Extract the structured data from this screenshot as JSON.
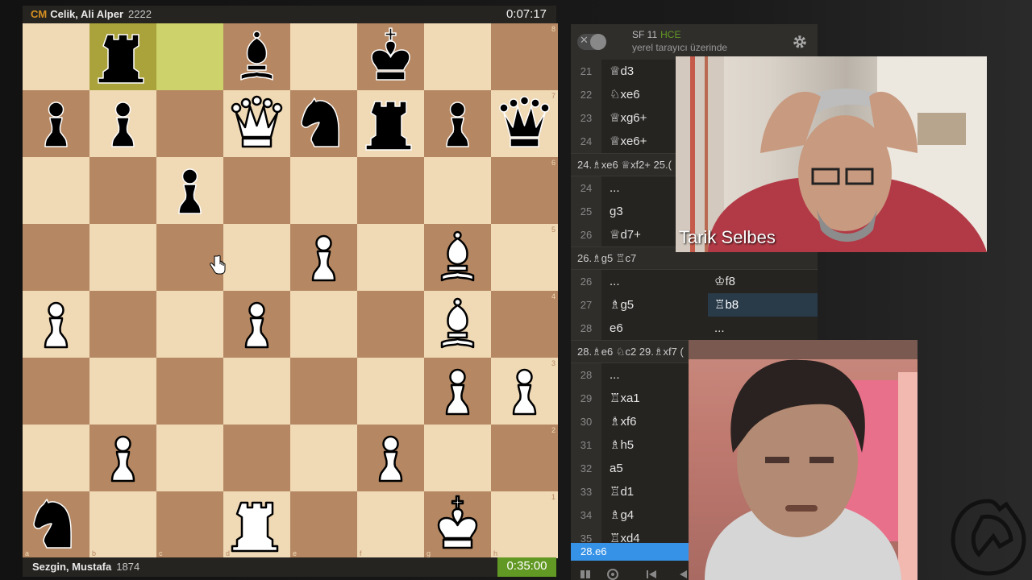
{
  "top_player": {
    "title": "CM",
    "name": "Celik, Ali Alper",
    "rating": "2222",
    "clock": "0:07:17"
  },
  "bottom_player": {
    "name": "Sezgin, Mustafa",
    "rating": "1874",
    "clock": "0:35:00"
  },
  "board": {
    "orientation": "white",
    "highlight_squares": [
      "b8",
      "c8"
    ],
    "pieces": [
      {
        "square": "b8",
        "piece": "rook",
        "color": "black"
      },
      {
        "square": "d8",
        "piece": "bishop",
        "color": "black"
      },
      {
        "square": "f8",
        "piece": "king",
        "color": "black"
      },
      {
        "square": "a7",
        "piece": "pawn",
        "color": "black"
      },
      {
        "square": "b7",
        "piece": "pawn",
        "color": "black"
      },
      {
        "square": "d7",
        "piece": "queen",
        "color": "white"
      },
      {
        "square": "e7",
        "piece": "knight",
        "color": "black"
      },
      {
        "square": "f7",
        "piece": "rook",
        "color": "black"
      },
      {
        "square": "g7",
        "piece": "pawn",
        "color": "black"
      },
      {
        "square": "h7",
        "piece": "queen",
        "color": "black"
      },
      {
        "square": "c6",
        "piece": "pawn",
        "color": "black"
      },
      {
        "square": "e5",
        "piece": "pawn",
        "color": "white"
      },
      {
        "square": "g5",
        "piece": "bishop",
        "color": "white"
      },
      {
        "square": "a4",
        "piece": "pawn",
        "color": "white"
      },
      {
        "square": "d4",
        "piece": "pawn",
        "color": "white"
      },
      {
        "square": "g4",
        "piece": "bishop",
        "color": "white"
      },
      {
        "square": "g3",
        "piece": "pawn",
        "color": "white"
      },
      {
        "square": "h3",
        "piece": "pawn",
        "color": "white"
      },
      {
        "square": "b2",
        "piece": "pawn",
        "color": "white"
      },
      {
        "square": "f2",
        "piece": "pawn",
        "color": "white"
      },
      {
        "square": "a1",
        "piece": "knight",
        "color": "black"
      },
      {
        "square": "d1",
        "piece": "rook",
        "color": "white"
      },
      {
        "square": "g1",
        "piece": "king",
        "color": "white"
      }
    ],
    "rank_labels": [
      "8",
      "7",
      "6",
      "5",
      "4",
      "3",
      "2",
      "1"
    ],
    "file_labels": [
      "a",
      "b",
      "c",
      "d",
      "e",
      "f",
      "g",
      "h"
    ]
  },
  "engine": {
    "name": "SF 11",
    "mode": "HCE",
    "subtitle": "yerel tarayıcı üzerinde"
  },
  "moves": [
    {
      "type": "row",
      "num": "21",
      "white": "♕d3",
      "black": ""
    },
    {
      "type": "row",
      "num": "22",
      "white": "♘xe6",
      "black": ""
    },
    {
      "type": "row",
      "num": "23",
      "white": "♕xg6+",
      "black": ""
    },
    {
      "type": "row",
      "num": "24",
      "white": "♕xe6+",
      "black": ""
    },
    {
      "type": "comment",
      "text": "24.♗xe6 ♕xf2+ 25.("
    },
    {
      "type": "row",
      "num": "24",
      "white": "...",
      "black": ""
    },
    {
      "type": "row",
      "num": "25",
      "white": "g3",
      "black": ""
    },
    {
      "type": "row",
      "num": "26",
      "white": "♕d7+",
      "black": ""
    },
    {
      "type": "comment",
      "text": "26.♗g5 ♖c7"
    },
    {
      "type": "row",
      "num": "26",
      "white": "...",
      "black": "♔f8"
    },
    {
      "type": "row",
      "num": "27",
      "white": "♗g5",
      "black": "♖b8",
      "active": true
    },
    {
      "type": "row",
      "num": "28",
      "white": "e6",
      "black": "..."
    },
    {
      "type": "comment",
      "text": "28.♗e6 ♘c2 29.♗xf7 ("
    },
    {
      "type": "row",
      "num": "28",
      "white": "...",
      "black": ""
    },
    {
      "type": "row",
      "num": "29",
      "white": "♖xa1",
      "black": ""
    },
    {
      "type": "row",
      "num": "30",
      "white": "♗xf6",
      "black": ""
    },
    {
      "type": "row",
      "num": "31",
      "white": "♗h5",
      "black": ""
    },
    {
      "type": "row",
      "num": "32",
      "white": "a5",
      "black": ""
    },
    {
      "type": "row",
      "num": "33",
      "white": "♖d1",
      "black": ""
    },
    {
      "type": "row",
      "num": "34",
      "white": "♗g4",
      "black": ""
    },
    {
      "type": "row",
      "num": "35",
      "white": "♖xd4",
      "black": ""
    }
  ],
  "current_move": "28.e6",
  "webcam_top": {
    "label": "Tarik Selbes"
  },
  "colors": {
    "light_square": "#f0d9b5",
    "dark_square": "#b58863",
    "highlight": "#cdd26a",
    "active_clock": "#629924",
    "current_move": "#3692e7"
  }
}
